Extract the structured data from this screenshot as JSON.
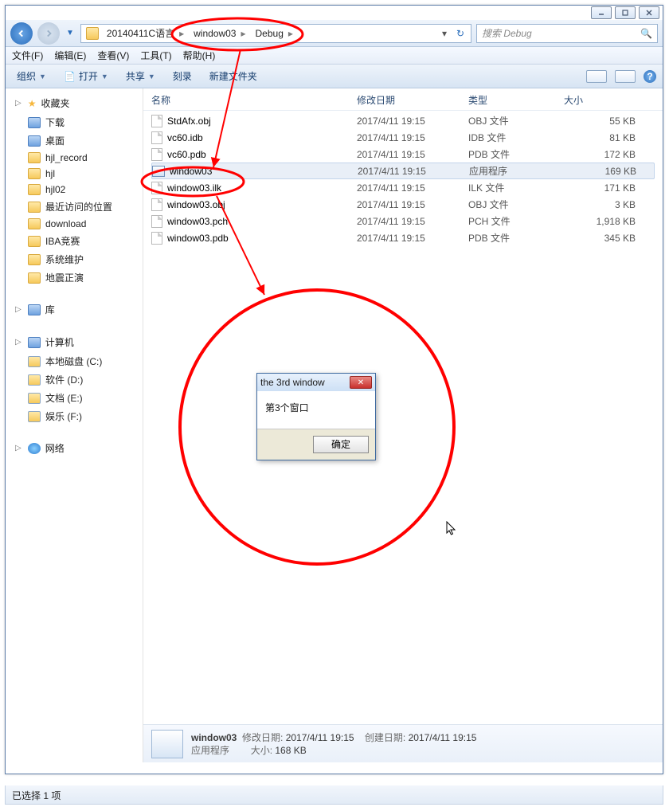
{
  "caption_buttons": [
    "minimize",
    "maximize",
    "close"
  ],
  "breadcrumb": [
    "20140411C语言",
    "window03",
    "Debug"
  ],
  "search_placeholder": "搜索 Debug",
  "menus": {
    "file": "文件(F)",
    "edit": "编辑(E)",
    "view": "查看(V)",
    "tools": "工具(T)",
    "help": "帮助(H)"
  },
  "toolbar": {
    "organize": "组织",
    "open": "打开",
    "share": "共享",
    "burn": "刻录",
    "newfolder": "新建文件夹"
  },
  "sidebar": {
    "favorites_title": "收藏夹",
    "favorites": [
      {
        "label": "下载",
        "icon": "blue"
      },
      {
        "label": "桌面",
        "icon": "blue"
      },
      {
        "label": "hjl_record",
        "icon": "folder"
      },
      {
        "label": "hjl",
        "icon": "folder"
      },
      {
        "label": "hjl02",
        "icon": "folder"
      },
      {
        "label": "最近访问的位置",
        "icon": "folder"
      },
      {
        "label": "download",
        "icon": "folder"
      },
      {
        "label": "IBA竞赛",
        "icon": "folder"
      },
      {
        "label": "系统维护",
        "icon": "folder"
      },
      {
        "label": "地震正演",
        "icon": "folder"
      }
    ],
    "libraries_title": "库",
    "computer_title": "计算机",
    "drives": [
      {
        "label": "本地磁盘 (C:)"
      },
      {
        "label": "软件 (D:)"
      },
      {
        "label": "文档 (E:)"
      },
      {
        "label": "娱乐 (F:)"
      }
    ],
    "network_title": "网络"
  },
  "columns": {
    "name": "名称",
    "modified": "修改日期",
    "type": "类型",
    "size": "大小"
  },
  "files": [
    {
      "name": "StdAfx.obj",
      "date": "2017/4/11 19:15",
      "type": "OBJ 文件",
      "size": "55 KB",
      "ic": "file"
    },
    {
      "name": "vc60.idb",
      "date": "2017/4/11 19:15",
      "type": "IDB 文件",
      "size": "81 KB",
      "ic": "file"
    },
    {
      "name": "vc60.pdb",
      "date": "2017/4/11 19:15",
      "type": "PDB 文件",
      "size": "172 KB",
      "ic": "file"
    },
    {
      "name": "window03",
      "date": "2017/4/11 19:15",
      "type": "应用程序",
      "size": "169 KB",
      "ic": "exe",
      "selected": true
    },
    {
      "name": "window03.ilk",
      "date": "2017/4/11 19:15",
      "type": "ILK 文件",
      "size": "171 KB",
      "ic": "file"
    },
    {
      "name": "window03.obj",
      "date": "2017/4/11 19:15",
      "type": "OBJ 文件",
      "size": "3 KB",
      "ic": "file"
    },
    {
      "name": "window03.pch",
      "date": "2017/4/11 19:15",
      "type": "PCH 文件",
      "size": "1,918 KB",
      "ic": "file"
    },
    {
      "name": "window03.pdb",
      "date": "2017/4/11 19:15",
      "type": "PDB 文件",
      "size": "345 KB",
      "ic": "file"
    }
  ],
  "details": {
    "name": "window03",
    "type": "应用程序",
    "mod_key": "修改日期:",
    "mod_val": "2017/4/11 19:15",
    "size_key": "大小:",
    "size_val": "168 KB",
    "cre_key": "创建日期:",
    "cre_val": "2017/4/11 19:15"
  },
  "statusbar": "已选择 1 项",
  "popup": {
    "title": "the 3rd window",
    "body": "第3个窗口",
    "ok": "确定"
  }
}
